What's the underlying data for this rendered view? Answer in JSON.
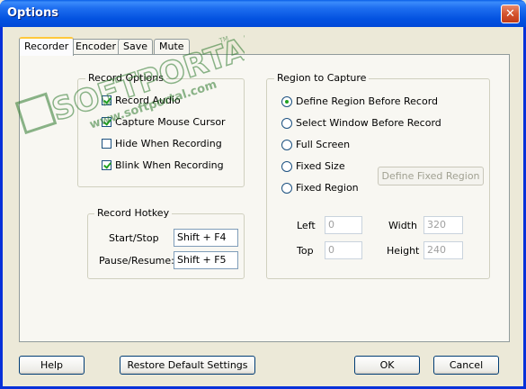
{
  "window": {
    "title": "Options",
    "close_glyph": "✕"
  },
  "tabs": [
    "Recorder",
    "Encoder",
    "Save",
    "Mute"
  ],
  "record_options": {
    "title": "Record Options",
    "items": [
      {
        "label": "Record Audio",
        "checked": true
      },
      {
        "label": "Capture Mouse Cursor",
        "checked": true
      },
      {
        "label": "Hide When Recording",
        "checked": false
      },
      {
        "label": "Blink When Recording",
        "checked": true
      }
    ]
  },
  "record_hotkey": {
    "title": "Record Hotkey",
    "start_stop_label": "Start/Stop",
    "start_stop_value": "Shift + F4",
    "pause_resume_label": "Pause/Resume:",
    "pause_resume_value": "Shift + F5"
  },
  "region": {
    "title": "Region to Capture",
    "options": [
      {
        "label": "Define Region Before Record",
        "checked": true
      },
      {
        "label": "Select Window Before Record",
        "checked": false
      },
      {
        "label": "Full Screen",
        "checked": false
      },
      {
        "label": "Fixed Size",
        "checked": false
      },
      {
        "label": "Fixed Region",
        "checked": false
      }
    ],
    "define_fixed_label": "Define Fixed Region",
    "left_label": "Left",
    "left_value": "0",
    "top_label": "Top",
    "top_value": "0",
    "width_label": "Width",
    "width_value": "320",
    "height_label": "Height",
    "height_value": "240"
  },
  "buttons": {
    "help": "Help",
    "restore": "Restore Default Settings",
    "ok": "OK",
    "cancel": "Cancel"
  },
  "watermark": {
    "brand": "SOFTPORTAL",
    "url": "www.softportal.com",
    "tm": "TM"
  }
}
